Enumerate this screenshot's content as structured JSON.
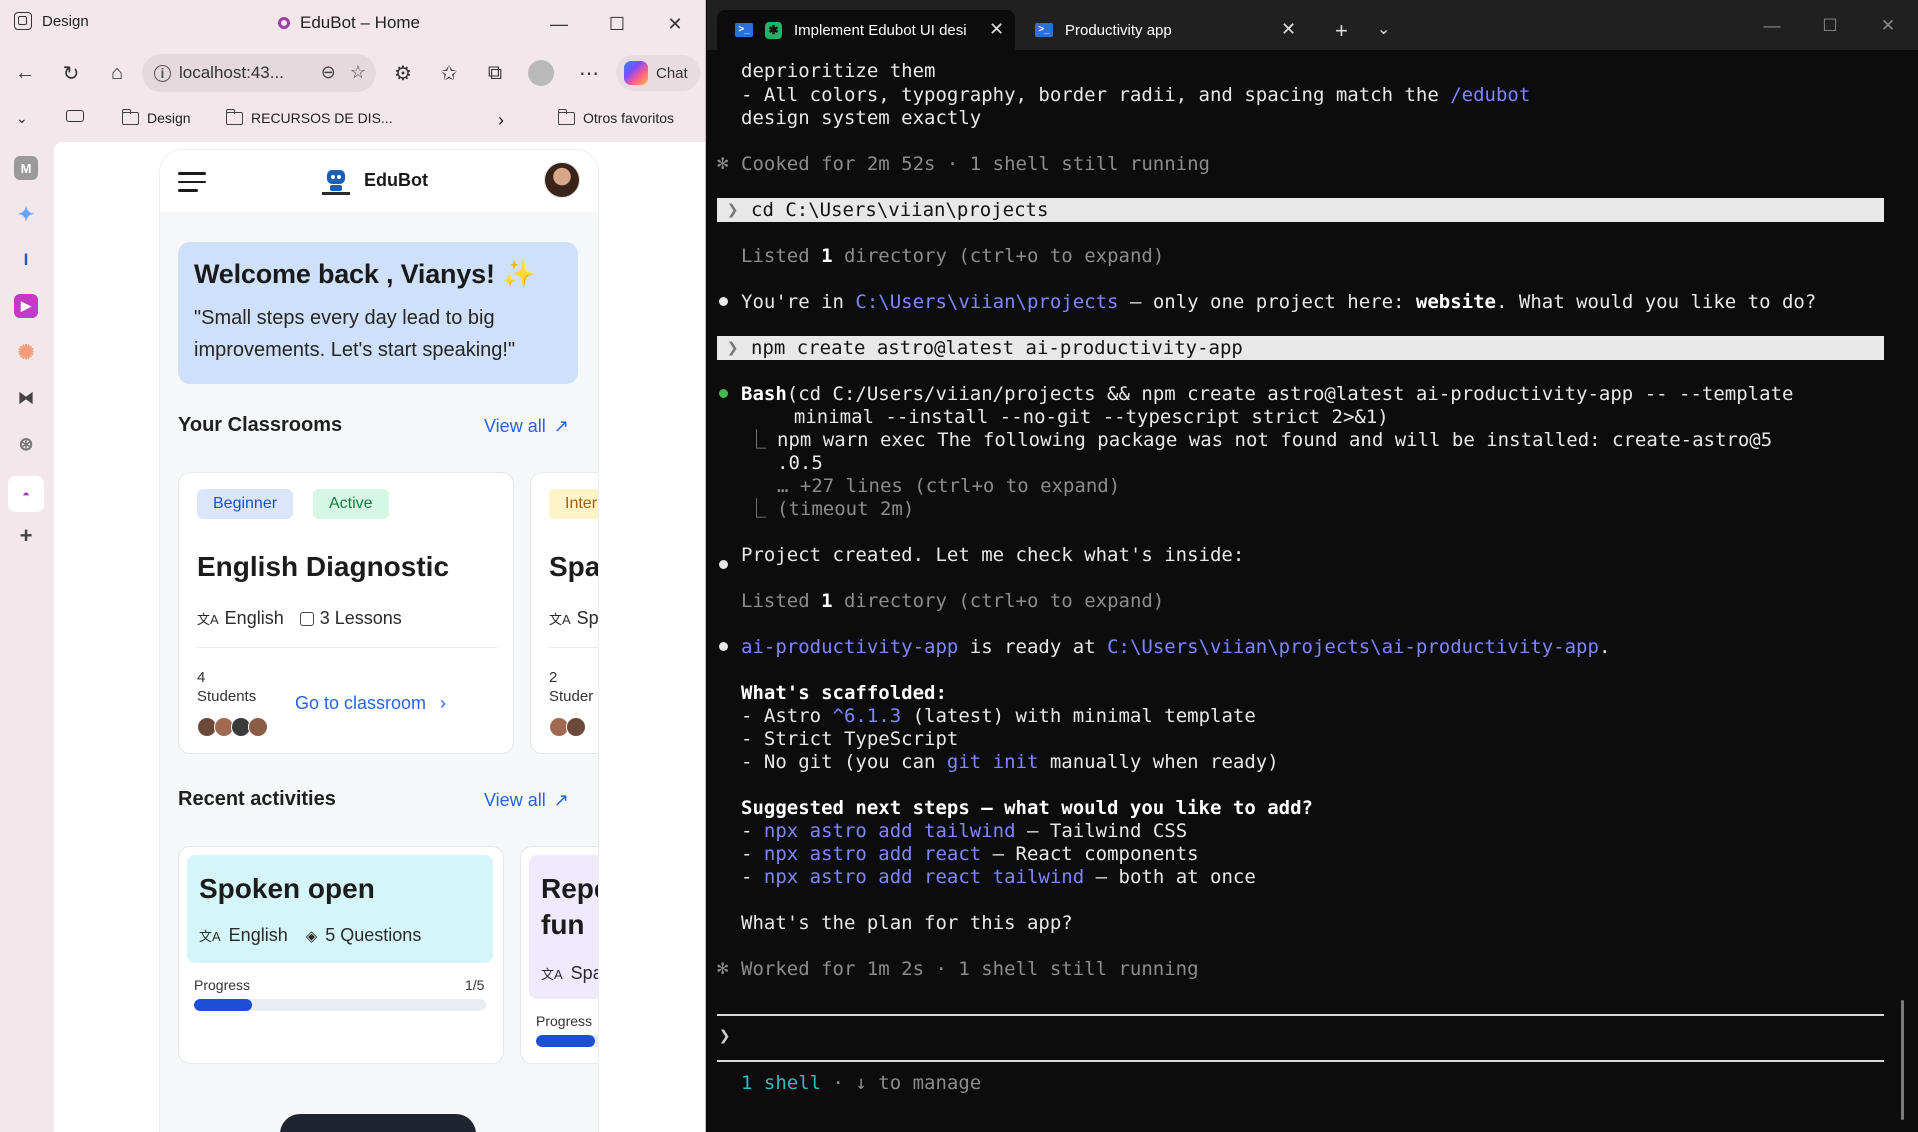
{
  "browser": {
    "workspace": "Design",
    "tab_title": "EduBot – Home",
    "url": "localhost:43...",
    "chat_label": "Chat",
    "bookmarks": [
      "Design",
      "RECURSOS DE DIS...",
      "Otros favoritos"
    ]
  },
  "app": {
    "brand": "EduBot",
    "welcome_title": "Welcome back , Vianys! ✨",
    "welcome_quote": "\"Small steps every day lead to big improvements. Let's start speaking!\"",
    "classrooms_title": "Your Classrooms",
    "view_all": "View all",
    "classrooms": [
      {
        "level": "Beginner",
        "status": "Active",
        "title": "English Diagnostic",
        "language": "English",
        "lessons": "3 Lessons",
        "students_count": "4",
        "students_label": "Students",
        "cta": "Go to classroom"
      },
      {
        "level": "Inter",
        "title": "Spa",
        "language": "Spa",
        "students_count": "2",
        "students_label": "Studer"
      }
    ],
    "activities_title": "Recent activities",
    "activities": [
      {
        "title": "Spoken open",
        "language": "English",
        "questions": "5 Questions",
        "progress_label": "Progress",
        "progress_text": "1/5",
        "progress": 0.2,
        "bg": "#d4f5f9"
      },
      {
        "title_1": "Repe",
        "title_2": "fun",
        "language": "Spa",
        "progress_label": "Progress",
        "progress": 0.45,
        "bg": "#efeafd"
      }
    ]
  },
  "terminal": {
    "tabs": [
      "Implement Edubot UI desi",
      "Productivity app"
    ],
    "lines": {
      "l1": "deprioritize them",
      "l2a": "- All colors, typography, border radii, and spacing match the ",
      "l2b": "/edubot",
      "l3": "design system exactly",
      "l4": "Cooked for 2m 52s · 1 shell still running",
      "cmd1": "cd C:\\Users\\viian\\projects",
      "l5": "Listed ",
      "l5n": "1",
      "l5b": " directory (ctrl+o to expand)",
      "l6a": "You're in ",
      "l6b": "C:\\Users\\viian\\projects",
      "l6c": " – only one project here: ",
      "l6d": "website",
      "l6e": ". What would you like to do?",
      "cmd2": "npm create astro@latest ai-productivity-app",
      "b1a": "Bash",
      "b1b": "(cd C:/Users/viian/projects && npm create astro@latest ai-productivity-app -- --template",
      "b2": "  minimal --install --no-git --typescript strict 2>&1)",
      "b3": "npm warn exec The following package was not found and will be installed: create-astro@5",
      "b4": ".0.5",
      "b5": "… +27 lines (ctrl+o to expand)",
      "b6": "(timeout 2m)",
      "p1": "Project created. Let me check what's inside:",
      "r1a": "ai-productivity-app",
      "r1b": " is ready at ",
      "r1c": "C:\\Users\\viian\\projects\\ai-productivity-app",
      "r1d": ".",
      "s1": "What's scaffolded:",
      "s2a": "- Astro ",
      "s2b": "^6.1.3",
      "s2c": " (latest) with minimal template",
      "s3": "- Strict TypeScript",
      "s4a": "- No git (you can ",
      "s4b": "git init",
      "s4c": " manually when ready)",
      "n1": "Suggested next steps – what would you like to add?",
      "n2a": "npx astro add tailwind",
      "n2b": " – Tailwind CSS",
      "n3a": "npx astro add react",
      "n3b": " – React components",
      "n4a": "npx astro add react tailwind",
      "n4b": " – both at once",
      "q": "What's the plan for this app?",
      "w": "Worked for 1m 2s · 1 shell still running",
      "prompt": "❯",
      "status_a": "1 shell",
      "status_b": " · ↓ to manage"
    }
  },
  "colors": {
    "accent": "#2563eb",
    "terminal_link": "#7f86ff",
    "bullet_green": "#3fb950"
  }
}
